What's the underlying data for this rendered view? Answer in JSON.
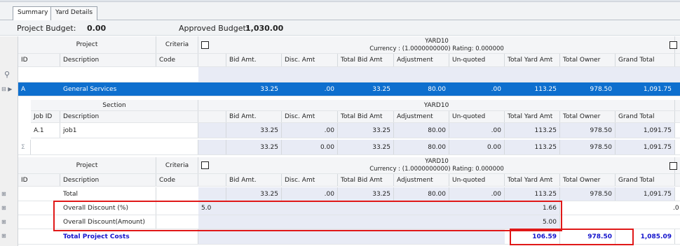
{
  "tabs": [
    {
      "label": "Summary"
    },
    {
      "label": "Yard Details"
    }
  ],
  "budget": {
    "project_label": "Project Budget:",
    "project_value": "0.00",
    "approved_label": "Approved Budget:",
    "approved_value": "1,030.00"
  },
  "project_header": {
    "project": "Project",
    "criteria": "Criteria",
    "yard_name": "YARD10",
    "yard_info": "Currency : (1.0000000000)   Rating: 0.000000"
  },
  "columns": {
    "id": "ID",
    "description": "Description",
    "code": "Code",
    "bid_amt": "Bid Amt.",
    "disc_amt": "Disc. Amt",
    "total_bid_amt": "Total Bid Amt",
    "adjustment": "Adjustment",
    "unquoted": "Un-quoted",
    "total_yard_amt": "Total Yard Amt",
    "total_owner": "Total Owner",
    "grand_total": "Grand Total"
  },
  "project_row": {
    "id": "A",
    "description": "General Services",
    "bid_amt": "33.25",
    "disc_amt": ".00",
    "total_bid_amt": "33.25",
    "adjustment": "80.00",
    "unquoted": ".00",
    "total_yard_amt": "113.25",
    "total_owner": "978.50",
    "grand_total": "1,091.75"
  },
  "section_header": {
    "section": "Section",
    "yard_name": "YARD10",
    "job_id": "Job ID",
    "description": "Description"
  },
  "job_row": {
    "job_id": "A.1",
    "description": "job1",
    "bid_amt": "33.25",
    "disc_amt": ".00",
    "total_bid_amt": "33.25",
    "adjustment": "80.00",
    "unquoted": ".00",
    "total_yard_amt": "113.25",
    "total_owner": "978.50",
    "grand_total": "1,091.75"
  },
  "section_sum": {
    "symbol": "Σ",
    "bid_amt": "33.25",
    "disc_amt": "0.00",
    "total_bid_amt": "33.25",
    "adjustment": "80.00",
    "unquoted": "0.00",
    "total_yard_amt": "113.25",
    "total_owner": "978.50",
    "grand_total": "1,091.75"
  },
  "summary": {
    "total_row": {
      "description": "Total",
      "bid_amt": "33.25",
      "disc_amt": ".00",
      "total_bid_amt": "33.25",
      "adjustment": "80.00",
      "unquoted": ".00",
      "total_yard_amt": "113.25",
      "total_owner": "978.50",
      "grand_total": "1,091.75"
    },
    "discount_pct_row": {
      "description": "Overall Discount (%)",
      "criteria_value": "5.0",
      "total_yard_amt": "1.66",
      "overflow": ".0"
    },
    "discount_amt_row": {
      "description": "Overall Discount(Amount)",
      "total_yard_amt": "5.00"
    },
    "project_costs_row": {
      "description": "Total Project Costs",
      "total_yard_amt": "106.59",
      "total_owner": "978.50",
      "grand_total": "1,085.09"
    }
  },
  "icons": {
    "filter": "funnel-icon",
    "expand": "expand-icon",
    "sum": "sigma-icon"
  },
  "colors": {
    "selection": "#0e6fce",
    "highlight_box": "#e01818",
    "emphasis_text": "#1212cc",
    "shaded_cells": "#e8ebf5"
  }
}
